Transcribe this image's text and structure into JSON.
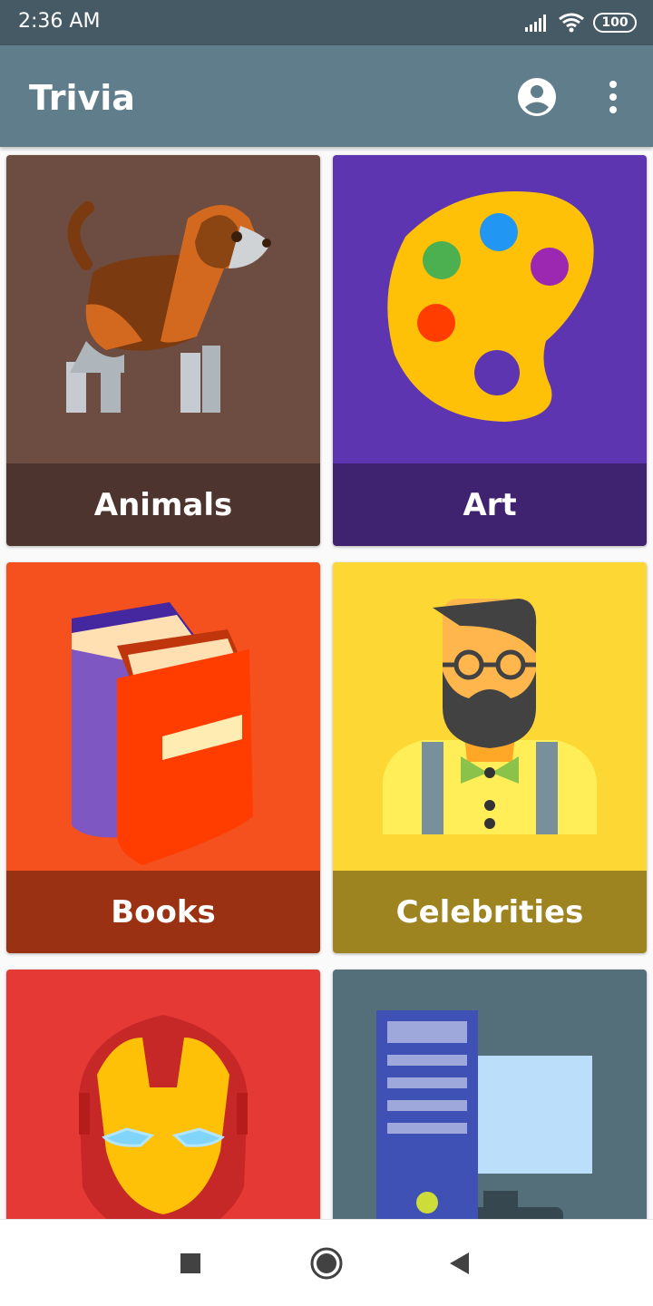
{
  "status_bar": {
    "time": "2:36 AM",
    "battery": "100",
    "icons": [
      "signal-icon",
      "wifi-icon",
      "battery-icon"
    ]
  },
  "app_bar": {
    "title": "Trivia",
    "actions": [
      "account-icon",
      "more-vert-icon"
    ]
  },
  "categories": [
    {
      "label": "Animals",
      "icon": "dog-icon",
      "color": "#6d4c41",
      "label_color": "#4e342e"
    },
    {
      "label": "Art",
      "icon": "palette-icon",
      "color": "#5e35b1",
      "label_color": "#3f2370"
    },
    {
      "label": "Books",
      "icon": "books-icon",
      "color": "#f4511e",
      "label_color": "#9a3112"
    },
    {
      "label": "Celebrities",
      "icon": "celebrity-icon",
      "color": "#fdd835",
      "label_color": "#9e8420"
    },
    {
      "label": "",
      "icon": "iron-man-icon",
      "color": "#e53935"
    },
    {
      "label": "",
      "icon": "computer-icon",
      "color": "#546e7a"
    }
  ],
  "nav_bar": {
    "buttons": [
      "recents-button",
      "home-button",
      "back-button"
    ]
  }
}
